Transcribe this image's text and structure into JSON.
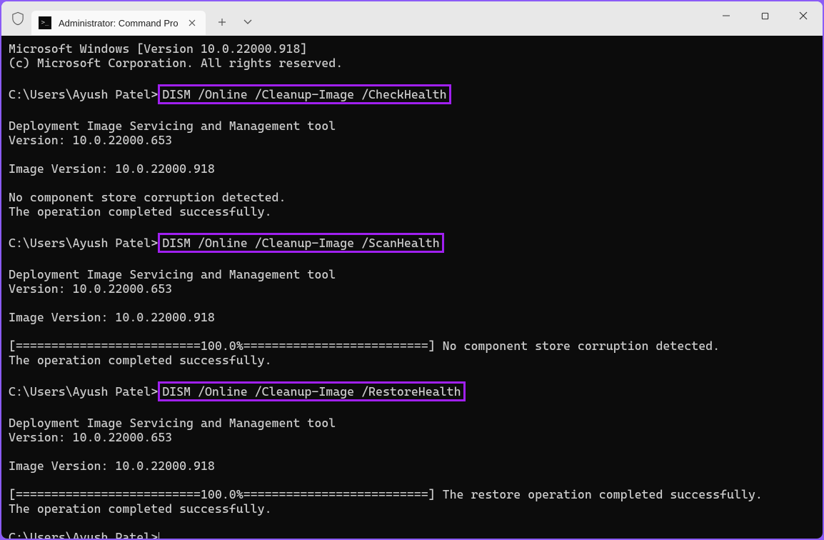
{
  "window": {
    "tab_title": "Administrator: Command Pro",
    "tab_icon": ">_"
  },
  "terminal": {
    "header_line1": "Microsoft Windows [Version 10.0.22000.918]",
    "header_line2": "(c) Microsoft Corporation. All rights reserved.",
    "prompt": "C:\\Users\\Ayush Patel>",
    "cmd1": "DISM /Online /Cleanup-Image /CheckHealth",
    "tool_name": "Deployment Image Servicing and Management tool",
    "version_line": "Version: 10.0.22000.653",
    "image_version": "Image Version: 10.0.22000.918",
    "result1_line1": "No component store corruption detected.",
    "result1_line2": "The operation completed successfully.",
    "cmd2": "DISM /Online /Cleanup-Image /ScanHealth",
    "progress_check": "[==========================100.0%==========================] No component store corruption detected.",
    "cmd3": "DISM /Online /Cleanup-Image /RestoreHealth",
    "progress_restore": "[==========================100.0%==========================] The restore operation completed successfully.",
    "op_completed": "The operation completed successfully."
  }
}
